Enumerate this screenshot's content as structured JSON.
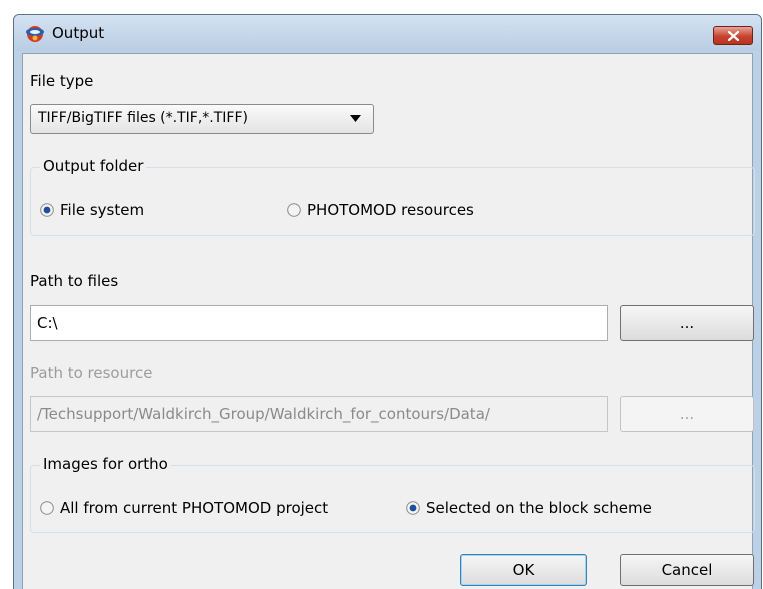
{
  "window": {
    "title": "Output",
    "close_label": "Close"
  },
  "file_type": {
    "label": "File type",
    "selected": "TIFF/BigTIFF files (*.TIF,*.TIFF)"
  },
  "output_folder": {
    "legend": "Output folder",
    "options": [
      {
        "label": "File system",
        "selected": true
      },
      {
        "label": "PHOTOMOD resources",
        "selected": false
      }
    ]
  },
  "path_to_files": {
    "label": "Path to files",
    "value": "C:\\",
    "browse_label": "..."
  },
  "path_to_resource": {
    "label": "Path to resource",
    "value": "/Techsupport/Waldkirch_Group/Waldkirch_for_contours/Data/",
    "browse_label": "...",
    "enabled": false
  },
  "images_for_ortho": {
    "legend": "Images for ortho",
    "options": [
      {
        "label": "All from current PHOTOMOD project",
        "selected": false
      },
      {
        "label": "Selected on the block scheme",
        "selected": true
      }
    ]
  },
  "buttons": {
    "ok": "OK",
    "cancel": "Cancel"
  },
  "colors": {
    "title_bar": "#bcd0e6",
    "close_button": "#c8432f",
    "dialog_bg": "#f0f0f0",
    "default_button_border": "#3c7fb1"
  }
}
